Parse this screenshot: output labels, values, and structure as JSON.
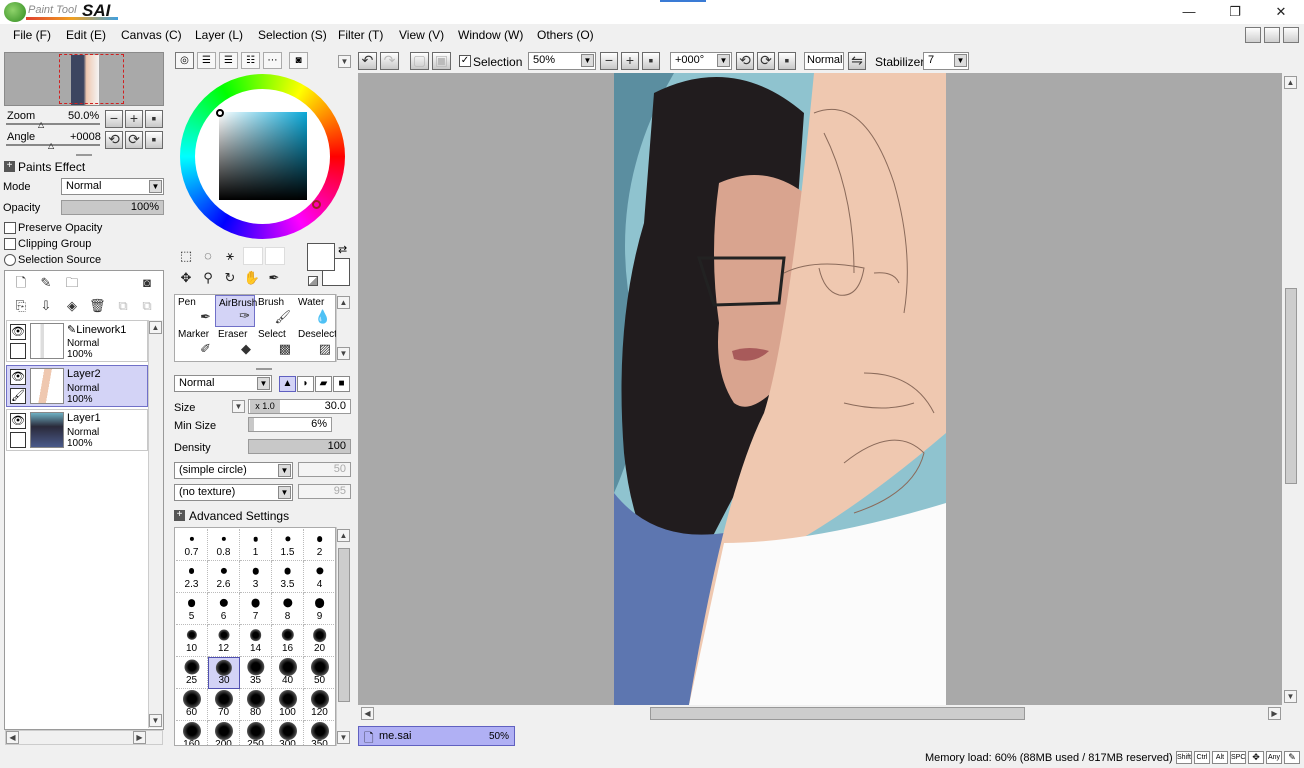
{
  "app": {
    "logo_text": "Paint Tool",
    "logo_name": "SAI",
    "window_buttons": [
      "—",
      "❐",
      "✕"
    ]
  },
  "menu": [
    "File (F)",
    "Edit (E)",
    "Canvas (C)",
    "Layer (L)",
    "Selection (S)",
    "Filter (T)",
    "View (V)",
    "Window (W)",
    "Others (O)"
  ],
  "navigator": {
    "zoom_label": "Zoom",
    "zoom_value": "50.0%",
    "angle_label": "Angle",
    "angle_value": "+0008"
  },
  "paint_effect": {
    "title": "Paints Effect",
    "mode_label": "Mode",
    "mode_value": "Normal",
    "opacity_label": "Opacity",
    "opacity_value": "100%",
    "opacity_fraction": 1.0,
    "preserve_opacity": "Preserve Opacity",
    "clipping_group": "Clipping Group",
    "selection_source": "Selection Source"
  },
  "layers": [
    {
      "name": "Linework1",
      "mode": "Normal",
      "opacity": "100%",
      "selected": false
    },
    {
      "name": "Layer2",
      "mode": "Normal",
      "opacity": "100%",
      "selected": true
    },
    {
      "name": "Layer1",
      "mode": "Normal",
      "opacity": "100%",
      "selected": false
    }
  ],
  "tools": [
    {
      "name": "Pen",
      "icon": "pen-icon",
      "selected": false
    },
    {
      "name": "AirBrush",
      "icon": "airbrush-icon",
      "selected": true
    },
    {
      "name": "Brush",
      "icon": "brush-icon",
      "selected": false
    },
    {
      "name": "Water",
      "icon": "water-icon",
      "selected": false
    },
    {
      "name": "Marker",
      "icon": "marker-icon",
      "selected": false
    },
    {
      "name": "Eraser",
      "icon": "eraser-icon",
      "selected": false
    },
    {
      "name": "Select",
      "icon": "select-icon",
      "selected": false
    },
    {
      "name": "Deselect",
      "icon": "deselect-icon",
      "selected": false
    }
  ],
  "brush_settings": {
    "blend_mode": "Normal",
    "size_label": "Size",
    "size_multiplier": "x 1.0",
    "size_value": "30.0",
    "min_size_label": "Min Size",
    "min_size_value": "6%",
    "min_size_fraction": 0.06,
    "density_label": "Density",
    "density_value": "100",
    "density_fraction": 1.0,
    "shape": "(simple circle)",
    "shape_value": "50",
    "texture": "(no texture)",
    "texture_value": "95",
    "advanced": "Advanced Settings"
  },
  "brush_sizes": [
    "0.7",
    "0.8",
    "1",
    "1.5",
    "2",
    "2.3",
    "2.6",
    "3",
    "3.5",
    "4",
    "5",
    "6",
    "7",
    "8",
    "9",
    "10",
    "12",
    "14",
    "16",
    "20",
    "25",
    "30",
    "35",
    "40",
    "50",
    "60",
    "70",
    "80",
    "100",
    "120",
    "160",
    "200",
    "250",
    "300",
    "350"
  ],
  "selected_brush_size": "30",
  "toolbar": {
    "selection_label": "Selection",
    "zoom": "50%",
    "angle": "+000°",
    "blend": "Normal",
    "stabilizer_label": "Stabilizer",
    "stabilizer_value": "7"
  },
  "document_tab": {
    "name": "me.sai",
    "zoom": "50%"
  },
  "status": {
    "memory": "Memory load: 60% (88MB used / 817MB reserved)",
    "keys": [
      "Shift",
      "Ctrl",
      "Alt",
      "SPC",
      "✥",
      "Any",
      "✎"
    ]
  },
  "colors": {
    "accent": "#d3d3f6",
    "canvas_bg": "#a9a9a9",
    "skin": "#efc8b0",
    "sky": "#8fc3cf"
  }
}
